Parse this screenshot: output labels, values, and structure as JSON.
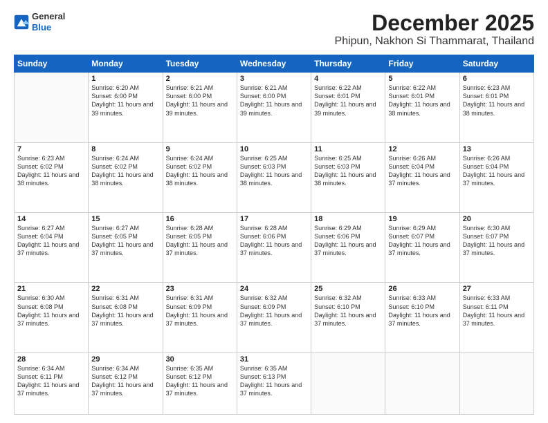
{
  "header": {
    "logo_line1": "General",
    "logo_line2": "Blue",
    "month": "December 2025",
    "location": "Phipun, Nakhon Si Thammarat, Thailand"
  },
  "days_of_week": [
    "Sunday",
    "Monday",
    "Tuesday",
    "Wednesday",
    "Thursday",
    "Friday",
    "Saturday"
  ],
  "weeks": [
    [
      {
        "day": "",
        "sunrise": "",
        "sunset": "",
        "daylight": ""
      },
      {
        "day": "1",
        "sunrise": "6:20 AM",
        "sunset": "6:00 PM",
        "daylight": "11 hours and 39 minutes."
      },
      {
        "day": "2",
        "sunrise": "6:21 AM",
        "sunset": "6:00 PM",
        "daylight": "11 hours and 39 minutes."
      },
      {
        "day": "3",
        "sunrise": "6:21 AM",
        "sunset": "6:00 PM",
        "daylight": "11 hours and 39 minutes."
      },
      {
        "day": "4",
        "sunrise": "6:22 AM",
        "sunset": "6:01 PM",
        "daylight": "11 hours and 39 minutes."
      },
      {
        "day": "5",
        "sunrise": "6:22 AM",
        "sunset": "6:01 PM",
        "daylight": "11 hours and 38 minutes."
      },
      {
        "day": "6",
        "sunrise": "6:23 AM",
        "sunset": "6:01 PM",
        "daylight": "11 hours and 38 minutes."
      }
    ],
    [
      {
        "day": "7",
        "sunrise": "6:23 AM",
        "sunset": "6:02 PM",
        "daylight": "11 hours and 38 minutes."
      },
      {
        "day": "8",
        "sunrise": "6:24 AM",
        "sunset": "6:02 PM",
        "daylight": "11 hours and 38 minutes."
      },
      {
        "day": "9",
        "sunrise": "6:24 AM",
        "sunset": "6:02 PM",
        "daylight": "11 hours and 38 minutes."
      },
      {
        "day": "10",
        "sunrise": "6:25 AM",
        "sunset": "6:03 PM",
        "daylight": "11 hours and 38 minutes."
      },
      {
        "day": "11",
        "sunrise": "6:25 AM",
        "sunset": "6:03 PM",
        "daylight": "11 hours and 38 minutes."
      },
      {
        "day": "12",
        "sunrise": "6:26 AM",
        "sunset": "6:04 PM",
        "daylight": "11 hours and 37 minutes."
      },
      {
        "day": "13",
        "sunrise": "6:26 AM",
        "sunset": "6:04 PM",
        "daylight": "11 hours and 37 minutes."
      }
    ],
    [
      {
        "day": "14",
        "sunrise": "6:27 AM",
        "sunset": "6:04 PM",
        "daylight": "11 hours and 37 minutes."
      },
      {
        "day": "15",
        "sunrise": "6:27 AM",
        "sunset": "6:05 PM",
        "daylight": "11 hours and 37 minutes."
      },
      {
        "day": "16",
        "sunrise": "6:28 AM",
        "sunset": "6:05 PM",
        "daylight": "11 hours and 37 minutes."
      },
      {
        "day": "17",
        "sunrise": "6:28 AM",
        "sunset": "6:06 PM",
        "daylight": "11 hours and 37 minutes."
      },
      {
        "day": "18",
        "sunrise": "6:29 AM",
        "sunset": "6:06 PM",
        "daylight": "11 hours and 37 minutes."
      },
      {
        "day": "19",
        "sunrise": "6:29 AM",
        "sunset": "6:07 PM",
        "daylight": "11 hours and 37 minutes."
      },
      {
        "day": "20",
        "sunrise": "6:30 AM",
        "sunset": "6:07 PM",
        "daylight": "11 hours and 37 minutes."
      }
    ],
    [
      {
        "day": "21",
        "sunrise": "6:30 AM",
        "sunset": "6:08 PM",
        "daylight": "11 hours and 37 minutes."
      },
      {
        "day": "22",
        "sunrise": "6:31 AM",
        "sunset": "6:08 PM",
        "daylight": "11 hours and 37 minutes."
      },
      {
        "day": "23",
        "sunrise": "6:31 AM",
        "sunset": "6:09 PM",
        "daylight": "11 hours and 37 minutes."
      },
      {
        "day": "24",
        "sunrise": "6:32 AM",
        "sunset": "6:09 PM",
        "daylight": "11 hours and 37 minutes."
      },
      {
        "day": "25",
        "sunrise": "6:32 AM",
        "sunset": "6:10 PM",
        "daylight": "11 hours and 37 minutes."
      },
      {
        "day": "26",
        "sunrise": "6:33 AM",
        "sunset": "6:10 PM",
        "daylight": "11 hours and 37 minutes."
      },
      {
        "day": "27",
        "sunrise": "6:33 AM",
        "sunset": "6:11 PM",
        "daylight": "11 hours and 37 minutes."
      }
    ],
    [
      {
        "day": "28",
        "sunrise": "6:34 AM",
        "sunset": "6:11 PM",
        "daylight": "11 hours and 37 minutes."
      },
      {
        "day": "29",
        "sunrise": "6:34 AM",
        "sunset": "6:12 PM",
        "daylight": "11 hours and 37 minutes."
      },
      {
        "day": "30",
        "sunrise": "6:35 AM",
        "sunset": "6:12 PM",
        "daylight": "11 hours and 37 minutes."
      },
      {
        "day": "31",
        "sunrise": "6:35 AM",
        "sunset": "6:13 PM",
        "daylight": "11 hours and 37 minutes."
      },
      {
        "day": "",
        "sunrise": "",
        "sunset": "",
        "daylight": ""
      },
      {
        "day": "",
        "sunrise": "",
        "sunset": "",
        "daylight": ""
      },
      {
        "day": "",
        "sunrise": "",
        "sunset": "",
        "daylight": ""
      }
    ]
  ]
}
